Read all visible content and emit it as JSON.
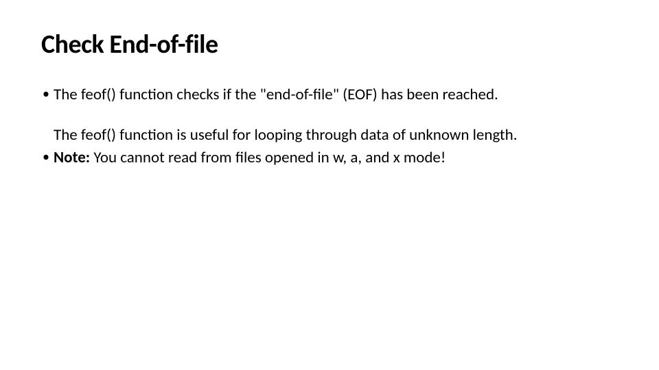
{
  "title": "Check End-of-file",
  "bullets": {
    "b1": "The feof() function checks if the \"end-of-file\" (EOF) has been reached.",
    "indent1": "The feof() function is useful for looping through data of unknown length.",
    "b2_label": "Note:",
    "b2_text": " You cannot read from files opened in w, a, and x mode!"
  }
}
